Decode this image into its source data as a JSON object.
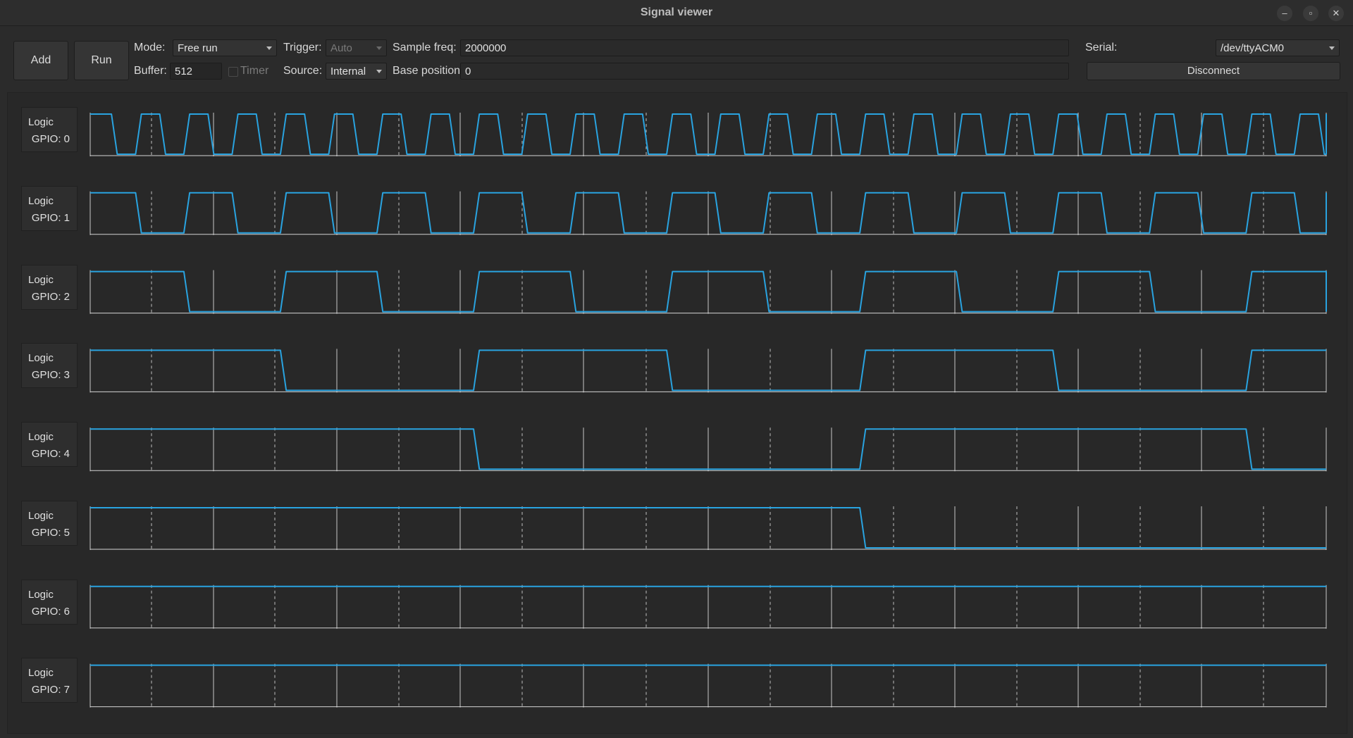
{
  "window": {
    "title": "Signal viewer",
    "minimize": "–",
    "maximize": "▫",
    "close": "✕"
  },
  "toolbar": {
    "add_label": "Add",
    "run_label": "Run",
    "mode_label": "Mode:",
    "mode_value": "Free run",
    "trigger_label": "Trigger:",
    "trigger_value": "Auto",
    "sample_freq_label": "Sample freq:",
    "sample_freq_value": "2000000",
    "buffer_label": "Buffer:",
    "buffer_value": "512",
    "timer_label": "Timer",
    "source_label": "Source:",
    "source_value": "Internal",
    "base_position_label": "Base position:",
    "base_position_value": "0",
    "serial_label": "Serial:",
    "serial_value": "/dev/ttyACM0",
    "disconnect_label": "Disconnect"
  },
  "colors": {
    "signal": "#29a3e0",
    "grid": "#e6e6e6",
    "background": "#2b2b2b"
  },
  "channels": [
    {
      "type": "Logic",
      "name": "GPIO: 0",
      "period_samples": 1
    },
    {
      "type": "Logic",
      "name": "GPIO: 1",
      "period_samples": 2
    },
    {
      "type": "Logic",
      "name": "GPIO: 2",
      "period_samples": 4
    },
    {
      "type": "Logic",
      "name": "GPIO: 3",
      "period_samples": 8
    },
    {
      "type": "Logic",
      "name": "GPIO: 4",
      "period_samples": 16
    },
    {
      "type": "Logic",
      "name": "GPIO: 5",
      "period_samples": 32
    },
    {
      "type": "Logic",
      "name": "GPIO: 6",
      "period_samples": 64
    },
    {
      "type": "Logic",
      "name": "GPIO: 7",
      "period_samples": 128
    }
  ]
}
